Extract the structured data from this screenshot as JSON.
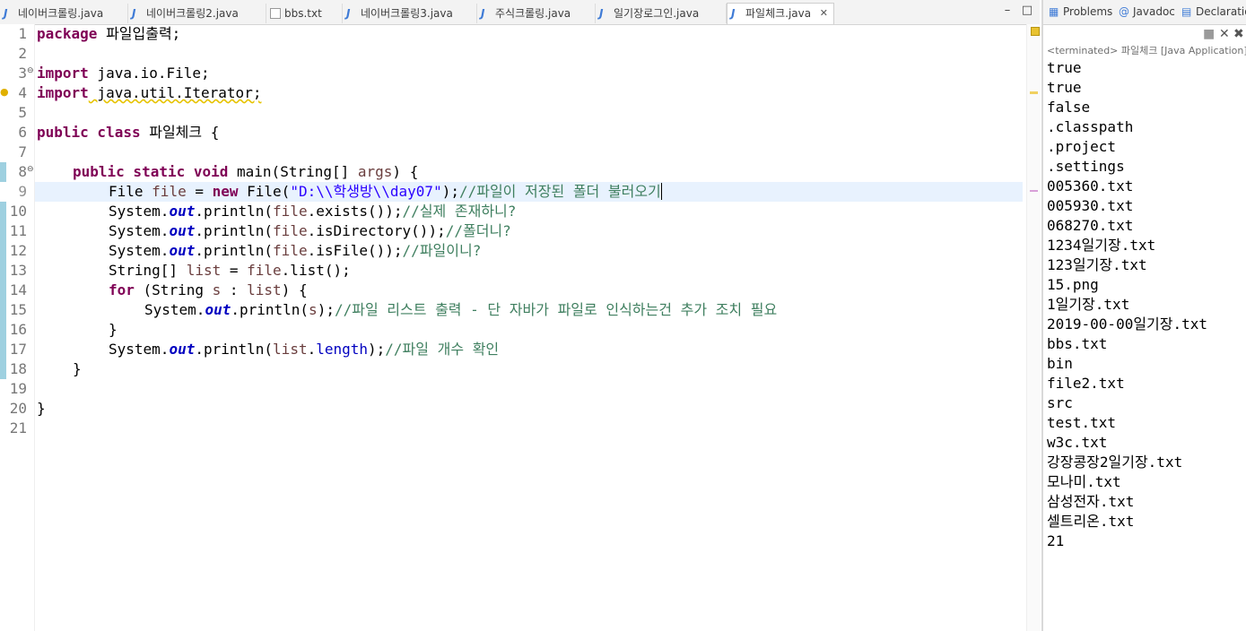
{
  "tabs": [
    {
      "label": "네이버크롤링.java",
      "icon": "java-file-icon"
    },
    {
      "label": "네이버크롤링2.java",
      "icon": "java-file-icon"
    },
    {
      "label": "bbs.txt",
      "icon": "text-file-icon"
    },
    {
      "label": "네이버크롤링3.java",
      "icon": "java-file-icon"
    },
    {
      "label": "주식크롤링.java",
      "icon": "java-file-icon"
    },
    {
      "label": "일기장로그인.java",
      "icon": "java-file-icon"
    },
    {
      "label": "파일체크.java",
      "icon": "java-file-icon",
      "active": true
    }
  ],
  "editor": {
    "line_numbers": [
      "1",
      "2",
      "3",
      "4",
      "5",
      "6",
      "7",
      "8",
      "9",
      "10",
      "11",
      "12",
      "13",
      "14",
      "15",
      "16",
      "17",
      "18",
      "19",
      "20",
      "21"
    ],
    "current_line": "9",
    "code": {
      "l1_kw": "package",
      "l1_rest": " 파일입출력;",
      "l3_kw": "import",
      "l3_rest": " java.io.File;",
      "l4_kw": "import",
      "l4_rest": " java.util.Iterator;",
      "l6_kw": "public class",
      "l6_rest": " 파일체크 {",
      "l8_kw": "public static void",
      "l8_rest1": " main(String[] ",
      "l8_var": "args",
      "l8_rest2": ") {",
      "l9_a": "File ",
      "l9_var": "file",
      "l9_b": " = ",
      "l9_kw": "new",
      "l9_c": " File(",
      "l9_str": "\"D:\\\\학생방\\\\day07\"",
      "l9_d": ");",
      "l9_cmt": "//파일이 저장된 폴더 불러오기",
      "l10_a": "System.",
      "l10_fld": "out",
      "l10_b": ".println(",
      "l10_var": "file",
      "l10_c": ".exists());",
      "l10_cmt": "//실제 존재하니?",
      "l11_a": "System.",
      "l11_fld": "out",
      "l11_b": ".println(",
      "l11_var": "file",
      "l11_c": ".isDirectory());",
      "l11_cmt": "//폴더니?",
      "l12_a": "System.",
      "l12_fld": "out",
      "l12_b": ".println(",
      "l12_var": "file",
      "l12_c": ".isFile());",
      "l12_cmt": "//파일이니?",
      "l13_a": "String[] ",
      "l13_var": "list",
      "l13_b": " = ",
      "l13_var2": "file",
      "l13_c": ".list();",
      "l14_kw": "for",
      "l14_a": " (String ",
      "l14_var": "s",
      "l14_b": " : ",
      "l14_var2": "list",
      "l14_c": ") {",
      "l15_a": "System.",
      "l15_fld": "out",
      "l15_b": ".println(",
      "l15_var": "s",
      "l15_c": ");",
      "l15_cmt": "//파일 리스트 출력 - 단 자바가 파일로 인식하는건 추가 조치 필요",
      "l16": "}",
      "l17_a": "System.",
      "l17_fld": "out",
      "l17_b": ".println(",
      "l17_var": "list",
      "l17_c": ".",
      "l17_fld2": "length",
      "l17_d": ");",
      "l17_cmt": "//파일 개수 확인",
      "l18": "}",
      "l20": "}"
    }
  },
  "console": {
    "tabs": [
      {
        "label": "Problems",
        "icon": "problems-icon"
      },
      {
        "label": "Javadoc",
        "icon": "javadoc-icon"
      },
      {
        "label": "Declaratio",
        "icon": "declaration-icon"
      }
    ],
    "status": "<terminated> 파일체크 [Java Application]",
    "output": [
      "true",
      "true",
      "false",
      ".classpath",
      ".project",
      ".settings",
      "005360.txt",
      "005930.txt",
      "068270.txt",
      "1234일기장.txt",
      "123일기장.txt",
      "15.png",
      "1일기장.txt",
      "2019-00-00일기장.txt",
      "bbs.txt",
      "bin",
      "file2.txt",
      "src",
      "test.txt",
      "w3c.txt",
      "강장콩장2일기장.txt",
      "모나미.txt",
      "삼성전자.txt",
      "셀트리온.txt",
      "21"
    ]
  }
}
